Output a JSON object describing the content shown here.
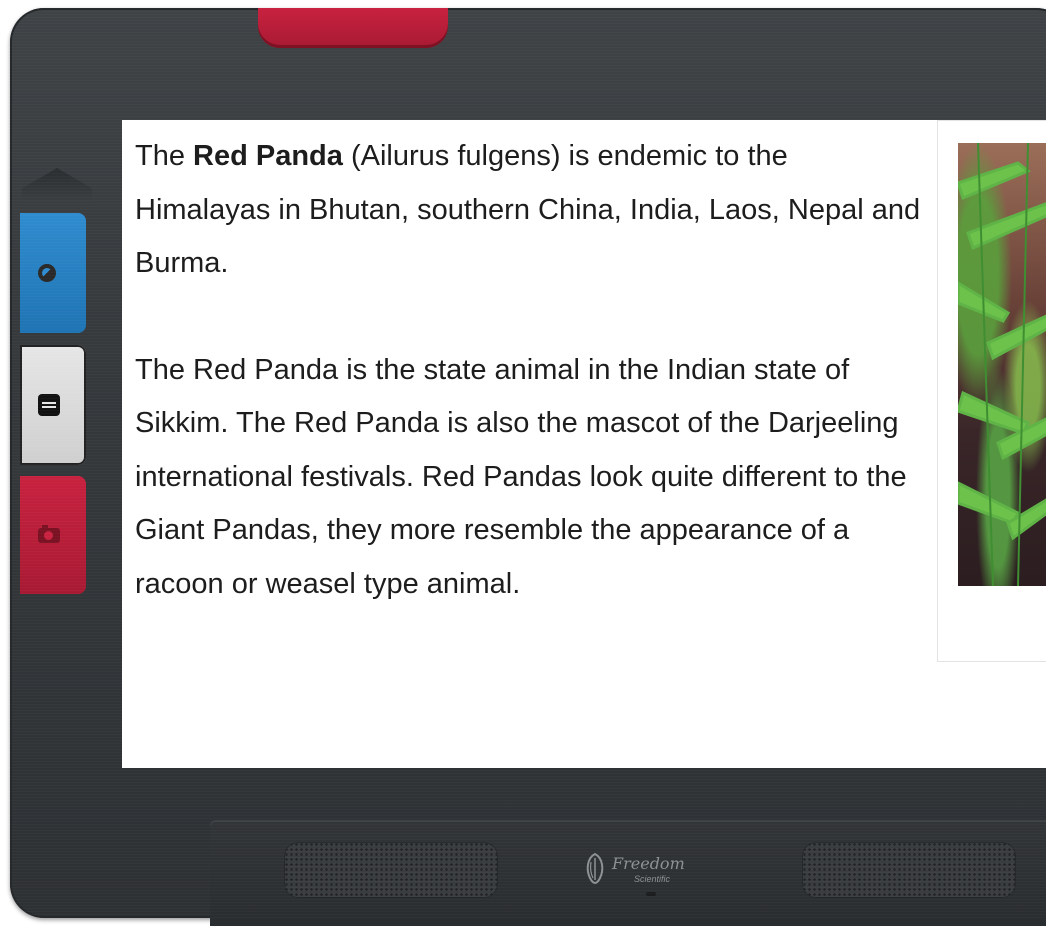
{
  "device": {
    "brand_name": "Freedom",
    "brand_sub": "Scientific",
    "colors": {
      "body": "#35393c",
      "accent_red": "#c8223f",
      "accent_blue": "#2f8ccf",
      "reading_gray": "#dcdcdc"
    }
  },
  "side_buttons": [
    {
      "name": "contrast",
      "icon": "contrast-icon",
      "color": "#2f8ccf"
    },
    {
      "name": "reading-mode",
      "icon": "text-document-icon",
      "color": "#dcdcdc"
    },
    {
      "name": "camera",
      "icon": "camera-icon",
      "color": "#c8223f"
    }
  ],
  "article": {
    "para1_pre": "The ",
    "para1_bold": "Red Panda",
    "para1_rest": " (Ailurus fulgens) is endemic to the Himalayas in Bhutan, southern China, India, Laos, Nepal and Burma.",
    "para2": "The Red Panda is the state animal in the Indian state of Sikkim. The Red Panda is also the mascot of the Darjeeling international festivals. Red Pandas look quite different to the Giant Pandas, they more resemble the appearance of a racoon or weasel type animal."
  },
  "photo": {
    "subject": "red-panda-with-bamboo"
  }
}
